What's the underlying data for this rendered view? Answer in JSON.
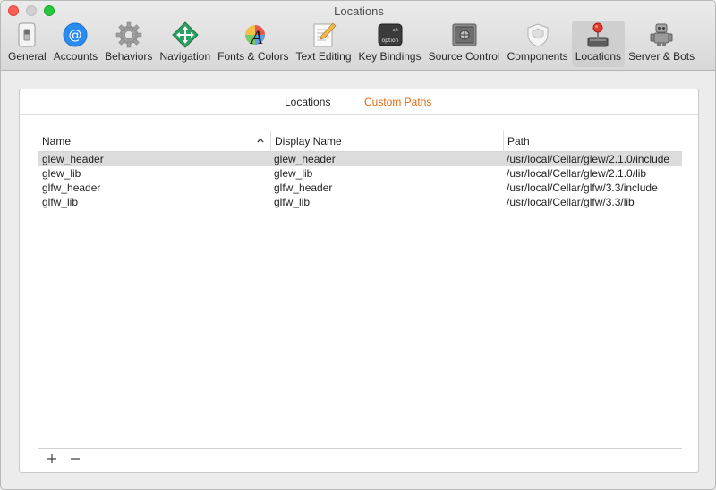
{
  "window": {
    "title": "Locations"
  },
  "toolbar": {
    "items": [
      {
        "label": "General",
        "icon": "switch-icon"
      },
      {
        "label": "Accounts",
        "icon": "at-sign-icon"
      },
      {
        "label": "Behaviors",
        "icon": "gear-icon"
      },
      {
        "label": "Navigation",
        "icon": "navigation-arrows-icon"
      },
      {
        "label": "Fonts & Colors",
        "icon": "font-color-icon"
      },
      {
        "label": "Text Editing",
        "icon": "text-edit-icon"
      },
      {
        "label": "Key Bindings",
        "icon": "option-key-icon"
      },
      {
        "label": "Source Control",
        "icon": "vault-icon"
      },
      {
        "label": "Components",
        "icon": "shield-icon"
      },
      {
        "label": "Locations",
        "icon": "joystick-icon",
        "active": true
      },
      {
        "label": "Server & Bots",
        "icon": "robot-icon"
      }
    ]
  },
  "tabs": {
    "locations": "Locations",
    "custom_paths": "Custom Paths"
  },
  "table": {
    "headers": {
      "name": "Name",
      "display_name": "Display Name",
      "path": "Path"
    },
    "rows": [
      {
        "name": "glew_header",
        "display_name": "glew_header",
        "path": "/usr/local/Cellar/glew/2.1.0/include",
        "selected": true
      },
      {
        "name": "glew_lib",
        "display_name": "glew_lib",
        "path": "/usr/local/Cellar/glew/2.1.0/lib"
      },
      {
        "name": "glfw_header",
        "display_name": "glfw_header",
        "path": "/usr/local/Cellar/glfw/3.3/include"
      },
      {
        "name": "glfw_lib",
        "display_name": "glfw_lib",
        "path": "/usr/local/Cellar/glfw/3.3/lib"
      }
    ]
  },
  "colors": {
    "active_tab": "#e26a0d",
    "selected_row": "#dcdcdc"
  }
}
